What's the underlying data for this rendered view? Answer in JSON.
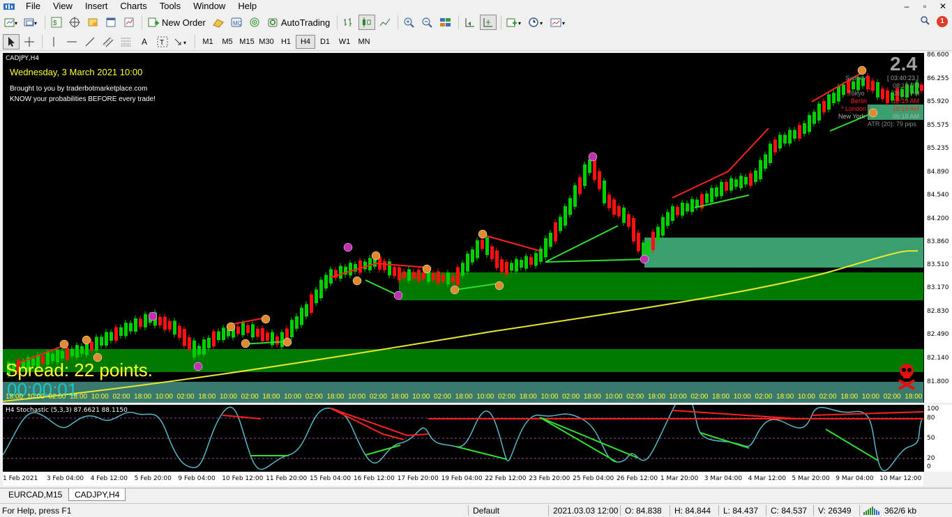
{
  "menu": {
    "items": [
      "File",
      "View",
      "Insert",
      "Charts",
      "Tools",
      "Window",
      "Help"
    ]
  },
  "toolbar": {
    "new_order_label": "New Order",
    "autotrading_label": "AutoTrading",
    "timeframes": [
      "M1",
      "M5",
      "M15",
      "M30",
      "H1",
      "H4",
      "D1",
      "W1",
      "MN"
    ],
    "active_timeframe": "H4",
    "notification_count": "1"
  },
  "chart": {
    "symbol_title": "CADJPY,H4",
    "date_text": "Wednesday, 3 March 2021 10:00",
    "promo_line1": "Brought to you by traderbotmarketplace.com",
    "promo_line2": "KNOW your probabilities BEFORE every trade!",
    "spread_text": "Spread: 22 points.",
    "timer_text": "00:00:01",
    "big_number": "2.4",
    "session_timer": "[ 03:40:23 ]",
    "sessions": [
      {
        "name": "Sydney",
        "time": "08:19 PM",
        "color": "#8a8a8a"
      },
      {
        "name": "Tokyo",
        "time": "08:19 PM",
        "color": "#8a8a8a"
      },
      {
        "name": "Berlin",
        "time": "10:19 AM",
        "color": "#ff2020"
      },
      {
        "name": "* London *",
        "time": "10:19 AM",
        "color": "#ff2020"
      },
      {
        "name": "New York",
        "time": "05:19 AM",
        "color": "#8a8a8a"
      }
    ],
    "atr_text": "ATR (20): 79 pips",
    "colors": {
      "bull": "#00d000",
      "bear": "#ff1010",
      "zone_dark": "#007a00",
      "zone_light": "#3a9e6e",
      "ma": "#e8e830"
    }
  },
  "price_axis": {
    "labels": [
      "86.600",
      "86.255",
      "85.920",
      "85.575",
      "85.235",
      "84.890",
      "84.540",
      "84.200",
      "83.860",
      "83.510",
      "83.170",
      "82.830",
      "82.490",
      "82.140",
      "81.800"
    ]
  },
  "stochastic": {
    "title": "H4 Stochastic (5,3,3) 87.6621 88.1150",
    "levels": [
      "100",
      "80",
      "50",
      "20",
      "0"
    ]
  },
  "time_axis": {
    "labels": [
      "1 Feb 2021",
      "3 Feb 04:00",
      "4 Feb 12:00",
      "5 Feb 20:00",
      "9 Feb 04:00",
      "10 Feb 12:00",
      "11 Feb 20:00",
      "15 Feb 04:00",
      "16 Feb 12:00",
      "17 Feb 20:00",
      "19 Feb 04:00",
      "22 Feb 12:00",
      "23 Feb 20:00",
      "25 Feb 04:00",
      "26 Feb 12:00",
      "1 Mar 20:00",
      "3 Mar 04:00",
      "4 Mar 12:00",
      "5 Mar 20:00",
      "9 Mar 04:00",
      "10 Mar 12:00"
    ],
    "chart_times": [
      "18:00",
      "10:00",
      "02:00",
      "18:00",
      "10:00",
      "02:00",
      "18:00",
      "10:00",
      "02:00",
      "18:00",
      "10:00",
      "02:00",
      "18:00",
      "10:00",
      "02:00",
      "18:00",
      "10:00",
      "02:00",
      "18:00",
      "10:00",
      "02:00",
      "18:00",
      "10:00",
      "02:00",
      "18:00",
      "10:00",
      "02:00",
      "18:00",
      "10:00",
      "02:00",
      "18:00",
      "10:00",
      "02:00",
      "18:00",
      "10:00",
      "02:00",
      "18:00",
      "10:00",
      "02:00",
      "18:00",
      "10:00",
      "02:00",
      "18:00"
    ]
  },
  "tabs": [
    "EURCAD,M15",
    "CADJPY,H4"
  ],
  "active_tab": "CADJPY,H4",
  "status": {
    "help": "For Help, press F1",
    "profile": "Default",
    "datetime": "2021.03.03 12:00",
    "open": "O: 84.838",
    "high": "H: 84.844",
    "low": "L: 84.437",
    "close": "C: 84.537",
    "volume": "V: 26349",
    "traffic": "362/6 kb"
  }
}
